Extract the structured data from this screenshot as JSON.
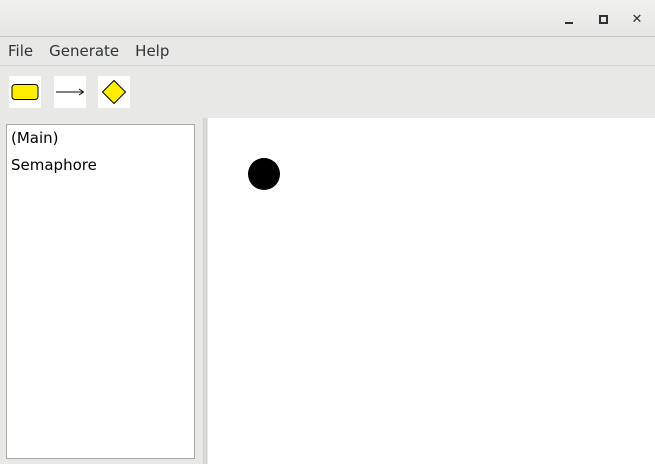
{
  "window": {
    "controls": {
      "minimize": "minimize-icon",
      "maximize": "maximize-icon",
      "close": "close-icon",
      "close_glyph": "✕"
    }
  },
  "menubar": {
    "items": [
      {
        "label": "File"
      },
      {
        "label": "Generate"
      },
      {
        "label": "Help"
      }
    ]
  },
  "toolbar": {
    "tools": [
      {
        "icon": "state-box-icon",
        "color": "#ffee00"
      },
      {
        "icon": "transition-arrow-icon",
        "color": "#000000"
      },
      {
        "icon": "decision-diamond-icon",
        "color": "#ffee00"
      }
    ]
  },
  "sidebar": {
    "items": [
      {
        "label": "(Main)"
      },
      {
        "label": "Semaphore"
      }
    ]
  },
  "canvas": {
    "background": "#ffffff",
    "nodes": [
      {
        "type": "initial-state",
        "color": "#000000"
      }
    ]
  }
}
